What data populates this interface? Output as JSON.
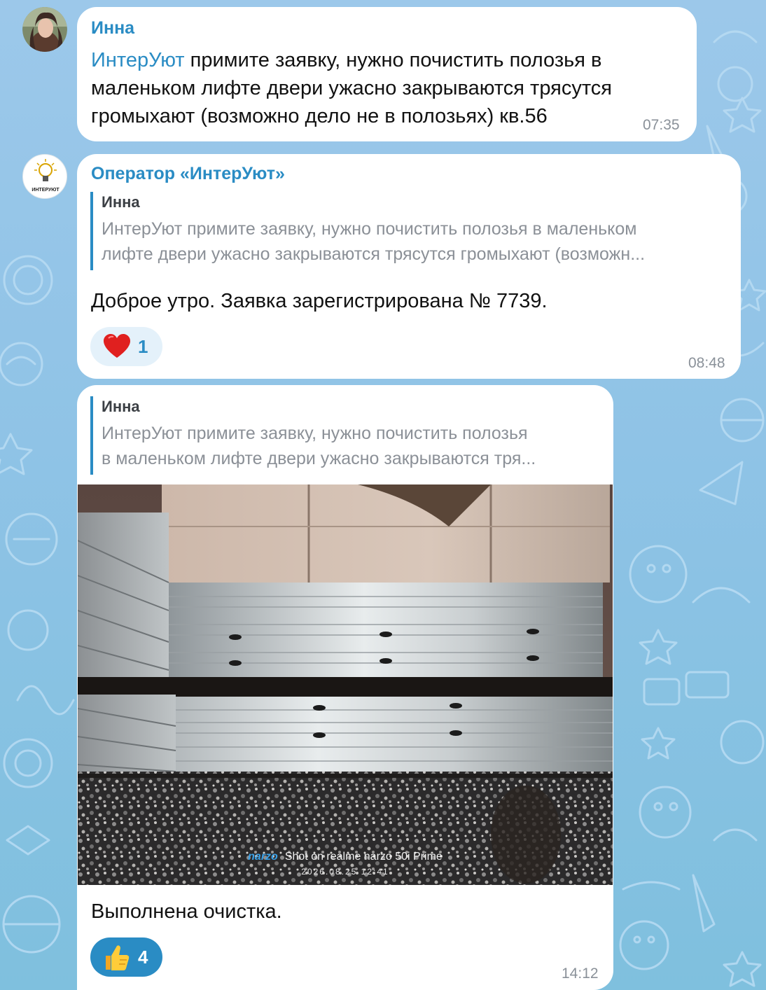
{
  "chat": {
    "messages": [
      {
        "sender": "Инна",
        "mention": "ИнтерУют",
        "lines": [
          " примите заявку, нужно почистить полозья в",
          "маленьком лифте двери ужасно закрываются трясутся",
          "громыхают (возможно дело не в полозьях) кв.56"
        ],
        "time": "07:35"
      },
      {
        "sender": "Оператор «ИнтерУют»",
        "avatar_text": "ИНТЕРУЮТ",
        "reply": {
          "name": "Инна",
          "lines": [
            "ИнтерУют примите заявку, нужно почистить полозья в маленьком",
            "лифте двери ужасно закрываются трясутся громыхают (возможн..."
          ]
        },
        "text": "Доброе утро. Заявка зарегистрирована № 7739.",
        "reaction": {
          "emoji": "heart-icon",
          "count": "1"
        },
        "time": "08:48"
      },
      {
        "reply": {
          "name": "Инна",
          "lines": [
            "ИнтерУют примите заявку, нужно почистить полозья",
            "в маленьком лифте двери ужасно закрываются тря..."
          ]
        },
        "photo": {
          "watermark_brand": "narzo",
          "watermark_text": "Shot on  realme narzo 50i Prime",
          "watermark_date": "2026.08.25  12:41"
        },
        "text": "Выполнена очистка.",
        "reaction": {
          "emoji": "thumbs-up-icon",
          "count": "4"
        },
        "time": "14:12"
      }
    ]
  },
  "colors": {
    "accent": "#2a8cc4",
    "background": "#8fc3e6",
    "bubble": "#ffffff",
    "time": "#8a9199"
  }
}
